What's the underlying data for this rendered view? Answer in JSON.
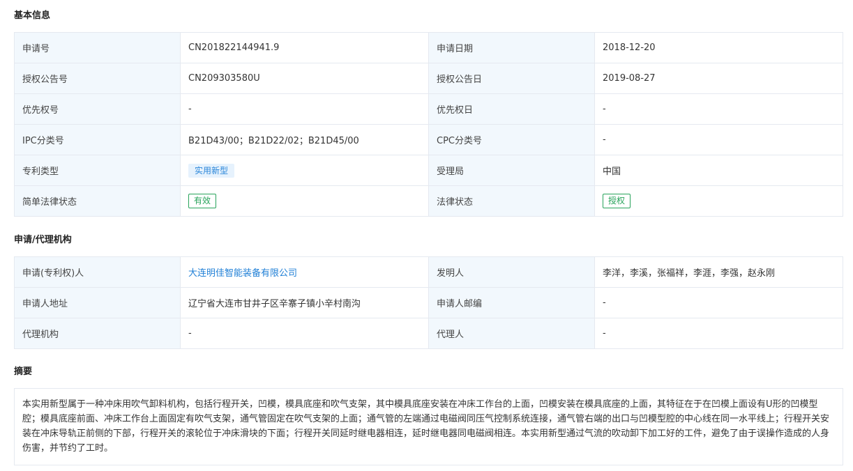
{
  "sections": {
    "basic": "基本信息",
    "agency": "申请/代理机构",
    "abstract": "摘要"
  },
  "basic": {
    "rows": [
      {
        "l1": "申请号",
        "v1": "CN201822144941.9",
        "l2": "申请日期",
        "v2": "2018-12-20"
      },
      {
        "l1": "授权公告号",
        "v1": "CN209303580U",
        "l2": "授权公告日",
        "v2": "2019-08-27"
      },
      {
        "l1": "优先权号",
        "v1": "-",
        "l2": "优先权日",
        "v2": "-"
      },
      {
        "l1": "IPC分类号",
        "v1": "B21D43/00；B21D22/02；B21D45/00",
        "l2": "CPC分类号",
        "v2": "-"
      },
      {
        "l1": "专利类型",
        "v1": "实用新型",
        "l2": "受理局",
        "v2": "中国"
      },
      {
        "l1": "简单法律状态",
        "v1": "有效",
        "l2": "法律状态",
        "v2": "授权"
      }
    ]
  },
  "agency": {
    "rows": [
      {
        "l1": "申请(专利权)人",
        "v1": "大连明佳智能装备有限公司",
        "l2": "发明人",
        "v2": "李洋，李溪，张福祥，李涯，李强，赵永刚"
      },
      {
        "l1": "申请人地址",
        "v1": "辽宁省大连市甘井子区辛寨子镇小辛村南沟",
        "l2": "申请人邮编",
        "v2": "-"
      },
      {
        "l1": "代理机构",
        "v1": "-",
        "l2": "代理人",
        "v2": "-"
      }
    ]
  },
  "abstract_text": "本实用新型属于一种冲床用吹气卸料机构，包括行程开关，凹模，模具底座和吹气支架，其中模具底座安装在冲床工作台的上面，凹模安装在模具底座的上面，其特征在于在凹模上面设有U形的凹模型腔；模具底座前面、冲床工作台上面固定有吹气支架，通气管固定在吹气支架的上面；通气管的左端通过电磁阀同压气控制系统连接，通气管右端的出口与凹模型腔的中心线在同一水平线上；行程开关安装在冲床导轨正前侧的下部，行程开关的滚轮位于冲床滑块的下面；行程开关同延时继电器相连，延时继电器同电磁阀相连。本实用新型通过气流的吹动卸下加工好的工件，避免了由于误操作造成的人身伤害，并节约了工时。",
  "colors": {
    "label_bg": "#f2f8fd",
    "border": "#e5e9f0",
    "link": "#1f7fd6",
    "tag_blue_bg": "#e6f2fd",
    "tag_blue_text": "#2b86d9",
    "tag_green": "#27a35a"
  }
}
